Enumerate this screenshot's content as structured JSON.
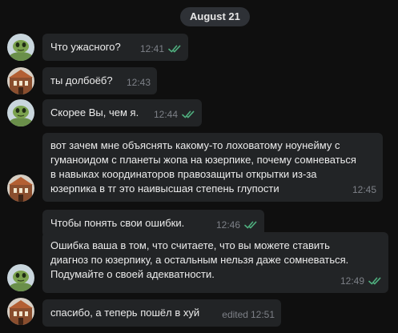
{
  "date_separator": "August 21",
  "colors": {
    "read_check": "#4fae7e",
    "bubble": "#222426",
    "background": "#0f0f0f"
  },
  "messages": [
    {
      "sender": "user-a",
      "text": "Что ужасного?",
      "time": "12:41",
      "read": true
    },
    {
      "sender": "user-b",
      "text": "ты долбоёб?",
      "time": "12:43",
      "read": false
    },
    {
      "sender": "user-a",
      "text": "Скорее Вы, чем я.",
      "time": "12:44",
      "read": true
    },
    {
      "sender": "user-b",
      "lines": [
        "вот зачем мне объяснять какому-то лоховатому ноунейму с",
        "гуманоидом с планеты жопа на юзерпике, почему сомневаться",
        "в навыках координаторов правозащиты открытки из-за",
        "юзерпика в тг это наивысшая степень глупости"
      ],
      "time": "12:45",
      "read": false
    },
    {
      "sender": "user-a",
      "text": "Чтобы понять свои ошибки.",
      "time": "12:46",
      "read": true
    },
    {
      "sender": "user-a",
      "lines": [
        "Ошибка ваша в том, что считаете, что вы можете ставить",
        "диагноз по юзерпику, а остальным нельзя даже сомневаться.",
        "Подумайте о своей адекватности."
      ],
      "time": "12:49",
      "read": true
    },
    {
      "sender": "user-b",
      "text": "спасибо, а теперь пошёл в хуй",
      "edited_label": "edited",
      "time": "12:51",
      "read": false
    }
  ]
}
